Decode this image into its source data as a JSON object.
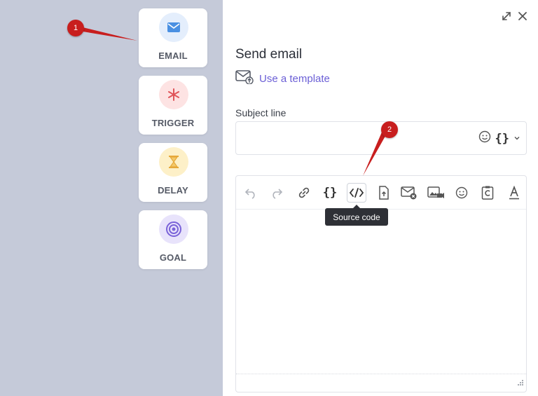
{
  "nodes": [
    {
      "label": "EMAIL",
      "icon": "envelope-icon",
      "color": "#4a90e2",
      "bg": "#e4eefc"
    },
    {
      "label": "TRIGGER",
      "icon": "asterisk-icon",
      "color": "#e0555a",
      "bg": "#fde3e3"
    },
    {
      "label": "DELAY",
      "icon": "hourglass-icon",
      "color": "#e6a93a",
      "bg": "#fdf0c8"
    },
    {
      "label": "GOAL",
      "icon": "target-icon",
      "color": "#7a63d9",
      "bg": "#e8e3fb"
    }
  ],
  "panel": {
    "title": "Send email",
    "template_link": "Use a template",
    "subject_label": "Subject line",
    "tooltip": "Source code"
  },
  "toolbar": [
    "undo-icon",
    "redo-icon",
    "link-icon",
    "variables-icon",
    "source-code-icon",
    "upload-file-icon",
    "email-remove-icon",
    "media-icon",
    "emoji-icon",
    "copyright-icon",
    "font-color-icon"
  ],
  "annotations": [
    "1",
    "2"
  ],
  "colors": {
    "accent": "#6b5fd6",
    "marker": "#c81e1e",
    "sidebar": "#c5cad9"
  }
}
